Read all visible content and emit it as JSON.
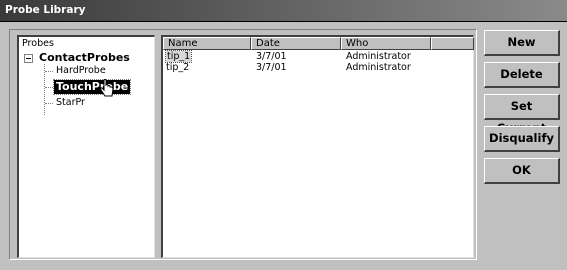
{
  "window": {
    "title": "Probe Library"
  },
  "tree": {
    "root_label": "Probes",
    "node_label": "ContactProbes",
    "children": [
      {
        "label": "HardProbe",
        "selected": false
      },
      {
        "label": "TouchProbe",
        "selected": true
      },
      {
        "label": "StarPr",
        "selected": false
      }
    ]
  },
  "list": {
    "columns": [
      "Name",
      "Date",
      "Who",
      ""
    ],
    "rows": [
      {
        "name": "tip_1",
        "date": "3/7/01",
        "who": "Administrator",
        "selected": true
      },
      {
        "name": "tip_2",
        "date": "3/7/01",
        "who": "Administrator",
        "selected": false
      }
    ]
  },
  "buttons": {
    "new": "New",
    "delete": "Delete",
    "set_current": "Set Current",
    "disqualify": "Disqualify",
    "ok": "OK"
  },
  "icons": {
    "cursor": "hand-pointer-icon",
    "expander": "tree-collapse-icon"
  }
}
